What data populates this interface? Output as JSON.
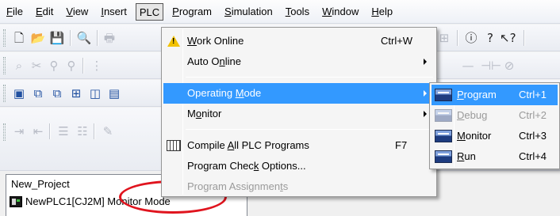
{
  "menubar": {
    "items": [
      {
        "label": "File",
        "key": "F",
        "rest": "ile"
      },
      {
        "label": "Edit",
        "key": "E",
        "rest": "dit"
      },
      {
        "label": "View",
        "key": "V",
        "rest": "iew"
      },
      {
        "label": "Insert",
        "key": "I",
        "rest": "nsert"
      },
      {
        "label": "PLC",
        "key": "",
        "rest": "PLC"
      },
      {
        "label": "Program",
        "key": "P",
        "rest": "rogram"
      },
      {
        "label": "Simulation",
        "key": "S",
        "rest": "imulation"
      },
      {
        "label": "Tools",
        "key": "T",
        "rest": "ools"
      },
      {
        "label": "Window",
        "key": "W",
        "rest": "indow"
      },
      {
        "label": "Help",
        "key": "H",
        "rest": "elp"
      }
    ],
    "active": "PLC"
  },
  "plc_menu": {
    "work_online": {
      "pre": "",
      "key": "W",
      "post": "ork Online",
      "accel": "Ctrl+W",
      "icon": "warning-icon"
    },
    "auto_online": {
      "pre": "Auto O",
      "key": "n",
      "post": "line"
    },
    "operating_mode": {
      "pre": "Operating ",
      "key": "M",
      "post": "ode"
    },
    "monitor": {
      "pre": "M",
      "key": "o",
      "post": "nitor"
    },
    "compile_all": {
      "pre": "Compile ",
      "key": "A",
      "post": "ll PLC Programs",
      "accel": "F7",
      "icon": "compile-icon"
    },
    "program_check": {
      "pre": "Program Chec",
      "key": "k",
      "post": " Options..."
    },
    "program_assignments": {
      "pre": "Program Assignmen",
      "key": "t",
      "post": "s"
    }
  },
  "mode_submenu": {
    "items": [
      {
        "pre": "",
        "key": "P",
        "post": "rogram",
        "accel": "Ctrl+1",
        "icon": "program-mode-icon",
        "state": "highlight"
      },
      {
        "pre": "",
        "key": "D",
        "post": "ebug",
        "accel": "Ctrl+2",
        "icon": "debug-mode-icon",
        "state": "disabled"
      },
      {
        "pre": "",
        "key": "M",
        "post": "onitor",
        "accel": "Ctrl+3",
        "icon": "monitor-mode-icon",
        "state": "normal"
      },
      {
        "pre": "",
        "key": "R",
        "post": "un",
        "accel": "Ctrl+4",
        "icon": "run-mode-icon",
        "state": "normal"
      }
    ]
  },
  "project_tree": {
    "root": "New_Project",
    "plc_node": "NewPLC1[CJ2M] Monitor Mode",
    "plc_node_prefix": "NewPLC1[CJ2M",
    "plc_node_suffix": "] Monitor Mode"
  },
  "toolbar": {
    "row1_icons": [
      "new-icon",
      "open-icon",
      "save-icon",
      "print-preview-icon",
      "print-icon",
      "info-icon",
      "help-icon",
      "context-help-icon"
    ],
    "row2_icons": [
      "zoom-icon",
      "cut-icon",
      "find-icon",
      "find-replace-icon",
      "grid-icon",
      "line-icon",
      "contact-icon"
    ],
    "row3_icons": [
      "window-icon",
      "view-a-icon",
      "view-b-icon",
      "view-c-icon",
      "view-d-icon",
      "view-e-icon"
    ],
    "row4_icons": [
      "indent-icon",
      "outdent-icon",
      "align-icon",
      "align-right-icon",
      "pencil-icon"
    ]
  },
  "colors": {
    "highlight": "#3399ff",
    "callout": "#e0141e",
    "warning": "#f2c200"
  }
}
